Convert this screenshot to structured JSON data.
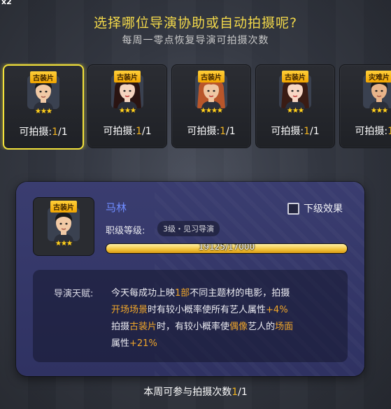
{
  "speed_label": "x2",
  "title": "选择哪位导演协助或自动拍摄呢?",
  "subtitle": "每周一零点恢复导演可拍摄次数",
  "shots_prefix": "可拍摄:",
  "cards": [
    {
      "tag": "古装片",
      "stars": "★★★",
      "used": "1",
      "total": "/1",
      "gender": "male",
      "hair": "#1a1a1a",
      "skin": "#f1c9a5",
      "selected": true
    },
    {
      "tag": "古装片",
      "stars": "★★★",
      "used": "1",
      "total": "/1",
      "gender": "female",
      "hair": "#2a1412",
      "skin": "#f5d4bf",
      "selected": false
    },
    {
      "tag": "古装片",
      "stars": "★★★★",
      "used": "1",
      "total": "/1",
      "gender": "female",
      "hair": "#b9562a",
      "skin": "#efc7a3",
      "selected": false
    },
    {
      "tag": "古装片",
      "stars": "★★★",
      "used": "1",
      "total": "/1",
      "gender": "female",
      "hair": "#3a1c14",
      "skin": "#f7d6c4",
      "selected": false
    },
    {
      "tag": "灾难片",
      "stars": "★★★",
      "used": "1",
      "total": "/1",
      "gender": "male",
      "hair": "#1a1a1a",
      "skin": "#e8b48a",
      "selected": false
    }
  ],
  "detail": {
    "tag": "古装片",
    "stars": "★★★",
    "name": "马林",
    "rank_label": "职级等级:",
    "rank_value": "3级・见习导演",
    "checkbox_label": "下级效果",
    "progress_text": "19125/17000",
    "progress_fraction": 1.0,
    "talent_label": "导演天赋:",
    "talent_lines": [
      [
        {
          "t": "今天每成功上映",
          "h": false
        },
        {
          "t": "1部",
          "h": true
        },
        {
          "t": "不同主题材的电影，拍摄",
          "h": false
        }
      ],
      [
        {
          "t": "开场场景",
          "h": true
        },
        {
          "t": "时有较小概率使所有艺人属性",
          "h": false
        },
        {
          "t": "+4%",
          "h": true
        }
      ],
      [
        {
          "t": "拍摄",
          "h": false
        },
        {
          "t": "古装片",
          "h": true
        },
        {
          "t": "时，有较小概率使",
          "h": false
        },
        {
          "t": "偶像",
          "h": true
        },
        {
          "t": "艺人的",
          "h": false
        },
        {
          "t": "场面",
          "h": true
        }
      ],
      [
        {
          "t": "属性",
          "h": false
        },
        {
          "t": "+21%",
          "h": true
        }
      ]
    ]
  },
  "footer": {
    "prefix": "本周可参与拍摄次数",
    "count": "1",
    "total": "/1"
  },
  "colors": {
    "accent": "#f2d84a",
    "highlight": "#f0a62a",
    "name": "#6f8cff",
    "selected_border": "#f3e23a"
  }
}
